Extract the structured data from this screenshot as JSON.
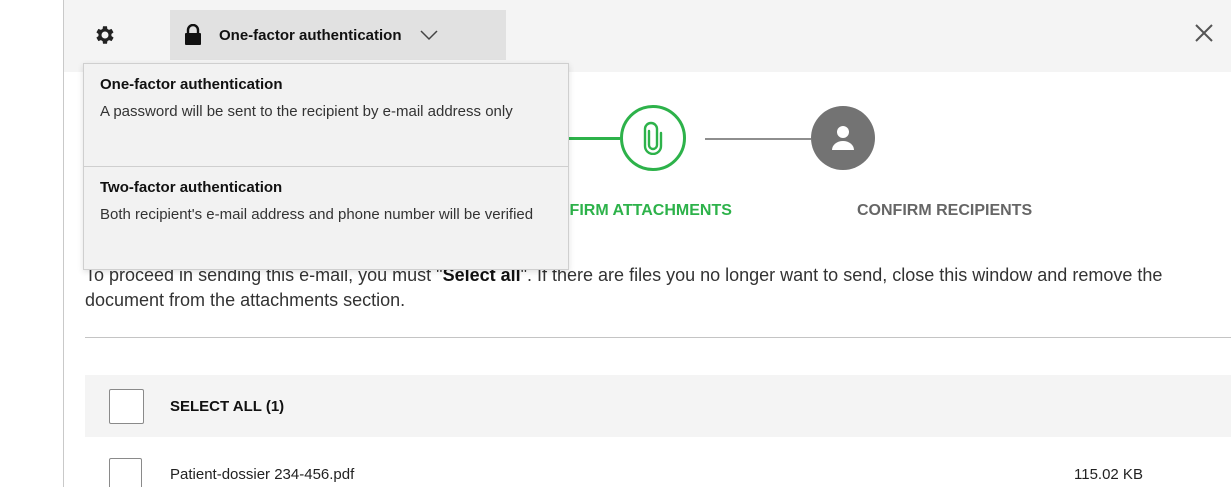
{
  "toolbar": {
    "settings_icon": "gear-icon",
    "auth_select": {
      "icon": "lock-icon",
      "selected_label": "One-factor authentication",
      "chevron_icon": "chevron-down-icon"
    },
    "close_icon": "close-icon"
  },
  "dropdown": {
    "options": [
      {
        "title": "One-factor authentication",
        "description": "A password will be sent to the recipient by e-mail address only"
      },
      {
        "title": "Two-factor authentication",
        "description": "Both recipient's e-mail address and phone number will be verified"
      }
    ]
  },
  "stepper": {
    "steps": [
      {
        "label": "CONFIRM ATTACHMENTS",
        "icon": "paperclip-icon",
        "state": "active"
      },
      {
        "label": "CONFIRM RECIPIENTS",
        "icon": "user-icon",
        "state": "inactive"
      }
    ]
  },
  "instructions": {
    "before": "To proceed in sending this e-mail, you must \"",
    "bold": "Select all",
    "after": "\". If there are files you no longer want to send, close this window and remove the document from the attachments section."
  },
  "attachments": {
    "select_all_label": "SELECT ALL (1)",
    "files": [
      {
        "name": "Patient-dossier 234-456.pdf",
        "size": "115.02 KB"
      }
    ]
  },
  "colors": {
    "accent_green": "#2db24a",
    "inactive_grey": "#737373",
    "toolbar_bg": "#f4f4f4",
    "dropdown_bg": "#f2f2f2"
  }
}
